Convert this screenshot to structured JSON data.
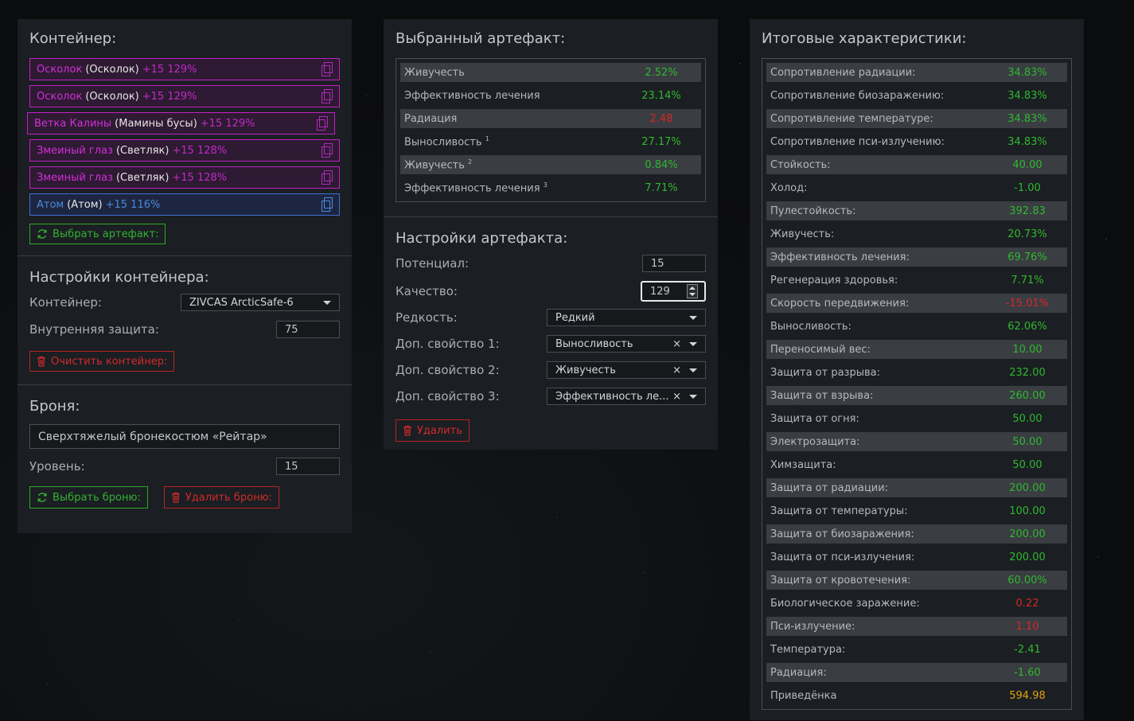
{
  "container_panel": {
    "title": "Контейнер:",
    "artifacts": [
      {
        "name": "Осколок",
        "base": "(Осколок)",
        "level": "+15 129%",
        "color": "purple"
      },
      {
        "name": "Осколок",
        "base": "(Осколок)",
        "level": "+15 129%",
        "color": "purple"
      },
      {
        "name": "Ветка Калины",
        "base": "(Мамины бусы)",
        "level": "+15 129%",
        "color": "purple"
      },
      {
        "name": "Змеиный глаз",
        "base": "(Светляк)",
        "level": "+15 128%",
        "color": "purple"
      },
      {
        "name": "Змеиный глаз",
        "base": "(Светляк)",
        "level": "+15 128%",
        "color": "purple"
      },
      {
        "name": "Атом",
        "base": "(Атом)",
        "level": "+15 116%",
        "color": "blue"
      }
    ],
    "select_artifact_button": "Выбрать артефакт:",
    "settings_title": "Настройки контейнера:",
    "container_label": "Контейнер:",
    "container_value": "ZIVCAS ArcticSafe-6",
    "inner_protection_label": "Внутренняя защита:",
    "inner_protection_value": "75",
    "clear_button": "Очистить контейнер:",
    "armor_title": "Броня:",
    "armor_value": "Сверхтяжелый бронекостюм «Рейтар»",
    "level_label": "Уровень:",
    "level_value": "15",
    "select_armor_button": "Выбрать броню:",
    "delete_armor_button": "Удалить броню:"
  },
  "artifact_panel": {
    "title": "Выбранный артефакт:",
    "stats": [
      {
        "label": "Живучесть",
        "sup": "",
        "value": "2.52%",
        "color": "green"
      },
      {
        "label": "Эффективность лечения",
        "sup": "",
        "value": "23.14%",
        "color": "green"
      },
      {
        "label": "Радиация",
        "sup": "",
        "value": "2.48",
        "color": "red"
      },
      {
        "label": "Выносливость",
        "sup": "1",
        "value": "27.17%",
        "color": "green"
      },
      {
        "label": "Живучесть",
        "sup": "2",
        "value": "0.84%",
        "color": "green"
      },
      {
        "label": "Эффективность лечения",
        "sup": "3",
        "value": "7.71%",
        "color": "green"
      }
    ],
    "settings_title": "Настройки артефакта:",
    "potential_label": "Потенциал:",
    "potential_value": "15",
    "quality_label": "Качество:",
    "quality_value": "129",
    "rarity_label": "Редкость:",
    "rarity_value": "Редкий",
    "extra1_label": "Доп. свойство 1:",
    "extra1_value": "Выносливость",
    "extra2_label": "Доп. свойство 2:",
    "extra2_value": "Живучесть",
    "extra3_label": "Доп. свойство 3:",
    "extra3_value": "Эффективность ле...",
    "clear_symbol": "×",
    "delete_button": "Удалить"
  },
  "totals_panel": {
    "title": "Итоговые характеристики:",
    "stats": [
      {
        "label": "Сопротивление радиации:",
        "value": "34.83%",
        "color": "green"
      },
      {
        "label": "Сопротивление биозаражению:",
        "value": "34.83%",
        "color": "green"
      },
      {
        "label": "Сопротивление температуре:",
        "value": "34.83%",
        "color": "green"
      },
      {
        "label": "Сопротивление пси-излучению:",
        "value": "34.83%",
        "color": "green"
      },
      {
        "label": "Стойкость:",
        "value": "40.00",
        "color": "green"
      },
      {
        "label": "Холод:",
        "value": "-1.00",
        "color": "green"
      },
      {
        "label": "Пулестойкость:",
        "value": "392.83",
        "color": "green"
      },
      {
        "label": "Живучесть:",
        "value": "20.73%",
        "color": "green"
      },
      {
        "label": "Эффективность лечения:",
        "value": "69.76%",
        "color": "green"
      },
      {
        "label": "Регенерация здоровья:",
        "value": "7.71%",
        "color": "green"
      },
      {
        "label": "Скорость передвижения:",
        "value": "-15.01%",
        "color": "red"
      },
      {
        "label": "Выносливость:",
        "value": "62.06%",
        "color": "green"
      },
      {
        "label": "Переносимый вес:",
        "value": "10.00",
        "color": "green"
      },
      {
        "label": "Защита от разрыва:",
        "value": "232.00",
        "color": "green"
      },
      {
        "label": "Защита от взрыва:",
        "value": "260.00",
        "color": "green"
      },
      {
        "label": "Защита от огня:",
        "value": "50.00",
        "color": "green"
      },
      {
        "label": "Электрозащита:",
        "value": "50.00",
        "color": "green"
      },
      {
        "label": "Химзащита:",
        "value": "50.00",
        "color": "green"
      },
      {
        "label": "Защита от радиации:",
        "value": "200.00",
        "color": "green"
      },
      {
        "label": "Защита от температуры:",
        "value": "100.00",
        "color": "green"
      },
      {
        "label": "Защита от биозаражения:",
        "value": "200.00",
        "color": "green"
      },
      {
        "label": "Защита от пси-излучения:",
        "value": "200.00",
        "color": "green"
      },
      {
        "label": "Защита от кровотечения:",
        "value": "60.00%",
        "color": "green"
      },
      {
        "label": "Биологическое заражение:",
        "value": "0.22",
        "color": "red"
      },
      {
        "label": "Пси-излучение:",
        "value": "1.10",
        "color": "red"
      },
      {
        "label": "Температура:",
        "value": "-2.41",
        "color": "green"
      },
      {
        "label": "Радиация:",
        "value": "-1.60",
        "color": "green"
      },
      {
        "label": "Приведёнка",
        "value": "594.98",
        "color": "yellow"
      }
    ]
  },
  "colors": {
    "green": "#2fb82f",
    "red": "#d62828",
    "yellow": "#e0a20c",
    "purple": "#c21fc6",
    "blue": "#3d6fd6"
  }
}
